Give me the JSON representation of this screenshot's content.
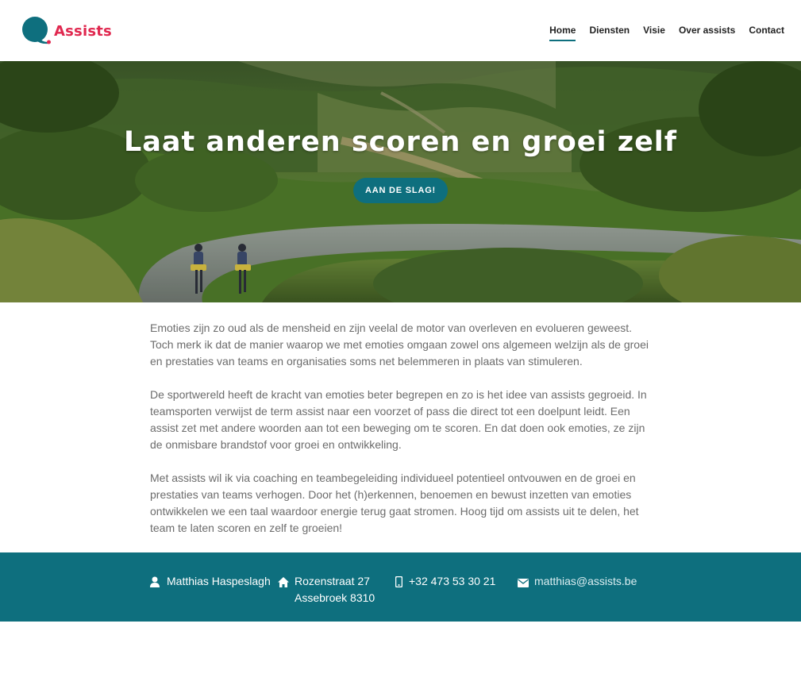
{
  "brand": {
    "name": "Assists",
    "accent": "#e0284f",
    "primary": "#0e6f7e"
  },
  "nav": {
    "items": [
      {
        "label": "Home",
        "active": true
      },
      {
        "label": "Diensten"
      },
      {
        "label": "Visie"
      },
      {
        "label": "Over assists"
      },
      {
        "label": "Contact"
      }
    ]
  },
  "hero": {
    "title": "Laat anderen scoren en groei zelf",
    "button_label": "AAN DE SLAG!"
  },
  "content": {
    "paragraphs": [
      "Emoties zijn zo oud als de mensheid en zijn veelal de motor van overleven en evolueren geweest. Toch merk ik dat de manier waarop we met emoties omgaan zowel ons algemeen welzijn als de groei en prestaties van teams en organisaties soms net belemmeren in plaats van stimuleren.",
      "De sportwereld heeft de kracht van emoties beter begrepen en zo is het idee van assists gegroeid. In teamsporten verwijst de term assist naar een voorzet of pass die direct tot een doelpunt leidt. Een assist zet met andere woorden aan tot een beweging om te scoren. En dat doen ook emoties, ze zijn de onmisbare brandstof voor groei en ontwikkeling.",
      "Met assists wil ik via coaching en teambegeleiding individueel potentieel ontvouwen en de groei en prestaties van teams verhogen. Door het (h)erkennen, benoemen en bewust inzetten van emoties ontwikkelen we een taal waardoor energie terug gaat stromen. Hoog tijd om assists uit te delen, het team te laten scoren en zelf te groeien!"
    ]
  },
  "footer": {
    "name": {
      "icon": "user-icon",
      "text": "Matthias Haspeslagh"
    },
    "address": {
      "icon": "home-icon",
      "line1": "Rozenstraat 27",
      "line2": "Assebroek 8310"
    },
    "phone": {
      "icon": "mobile-phone-icon",
      "text": "+32 473 53 30 21"
    },
    "email": {
      "icon": "envelope-icon",
      "text": "matthias@assists.be"
    }
  }
}
